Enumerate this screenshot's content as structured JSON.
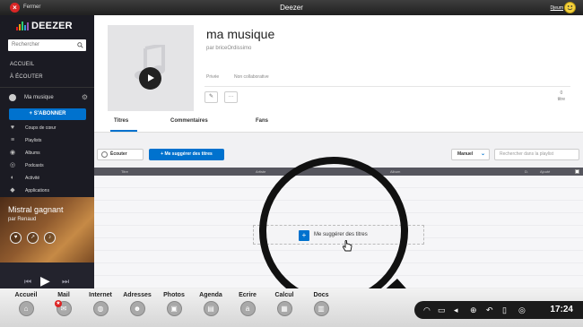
{
  "window": {
    "close_label": "Fermer",
    "title": "Deezer",
    "user_label": "Djeum"
  },
  "sidebar": {
    "logo": "DEEZER",
    "search_placeholder": "Rechercher",
    "nav": [
      {
        "label": "ACCUEIL"
      },
      {
        "label": "À ÉCOUTER"
      }
    ],
    "my_music_label": "Ma musique",
    "subscribe_label": "+ S'ABONNER",
    "menu": [
      {
        "label": "Coups de cœur",
        "icon": "heart-icon"
      },
      {
        "label": "Playlists",
        "icon": "playlist-icon"
      },
      {
        "label": "Albums",
        "icon": "album-icon"
      },
      {
        "label": "Podcasts",
        "icon": "podcast-icon"
      },
      {
        "label": "Activité",
        "icon": "activity-icon"
      },
      {
        "label": "Applications",
        "icon": "apps-icon"
      }
    ],
    "now_playing": {
      "title": "Mistral gagnant",
      "artist": "par Renaud"
    }
  },
  "playlist": {
    "title": "ma musique",
    "byline": "par briceOrdissimo",
    "privacy": "Privée",
    "collab": "Non collaborative",
    "count_value": "0",
    "count_label": "titre"
  },
  "tabs": [
    {
      "label": "Titres"
    },
    {
      "label": "Commentaires"
    },
    {
      "label": "Fans"
    }
  ],
  "toolbar": {
    "listen_label": "Écouter",
    "suggest_label": "+ Me suggérer des titres",
    "sort_value": "Manuel",
    "search_placeholder": "Rechercher dans la playlist"
  },
  "table": {
    "columns": [
      "Titre",
      "Artiste",
      "Album",
      "D.",
      "Ajouté"
    ]
  },
  "empty_state": {
    "suggest_label": "Me suggérer des titres"
  },
  "dock": {
    "apps": [
      {
        "label": "Accueil",
        "icon": "home-icon"
      },
      {
        "label": "Mail",
        "icon": "mail-icon"
      },
      {
        "label": "Internet",
        "icon": "globe-icon"
      },
      {
        "label": "Adresses",
        "icon": "contacts-icon"
      },
      {
        "label": "Photos",
        "icon": "photos-icon"
      },
      {
        "label": "Agenda",
        "icon": "calendar-icon"
      },
      {
        "label": "Ecrire",
        "icon": "write-icon"
      },
      {
        "label": "Calcul",
        "icon": "calculator-icon"
      },
      {
        "label": "Docs",
        "icon": "docs-icon"
      }
    ],
    "clock": "17:24"
  },
  "colors": {
    "accent": "#0072ce",
    "sidebar_bg": "#1b1b23",
    "close_red": "#d92626"
  }
}
